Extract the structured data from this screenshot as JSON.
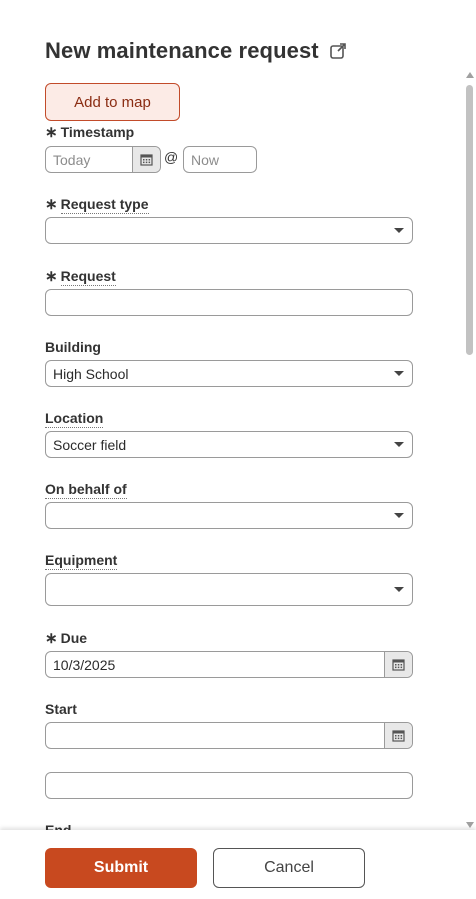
{
  "header": {
    "title": "New maintenance request",
    "open_icon": "external-link-icon"
  },
  "map_button": {
    "label": "Add to map"
  },
  "required_marker": "∗",
  "timestamp": {
    "label": "Timestamp",
    "date_placeholder": "Today",
    "at": "@",
    "time_placeholder": "Now"
  },
  "request_type": {
    "label": "Request type",
    "value": ""
  },
  "request": {
    "label": "Request",
    "value": ""
  },
  "building": {
    "label": "Building",
    "value": "High School"
  },
  "location": {
    "label": "Location",
    "value": "Soccer field"
  },
  "on_behalf_of": {
    "label": "On behalf of",
    "value": ""
  },
  "equipment": {
    "label": "Equipment",
    "value": ""
  },
  "due": {
    "label": "Due",
    "value": "10/3/2025"
  },
  "start": {
    "label": "Start",
    "date_value": "",
    "time_value": ""
  },
  "end": {
    "label": "End"
  },
  "footer": {
    "submit_label": "Submit",
    "cancel_label": "Cancel"
  },
  "colors": {
    "accent": "#c8491f",
    "map_button_bg": "#fcebe6"
  }
}
